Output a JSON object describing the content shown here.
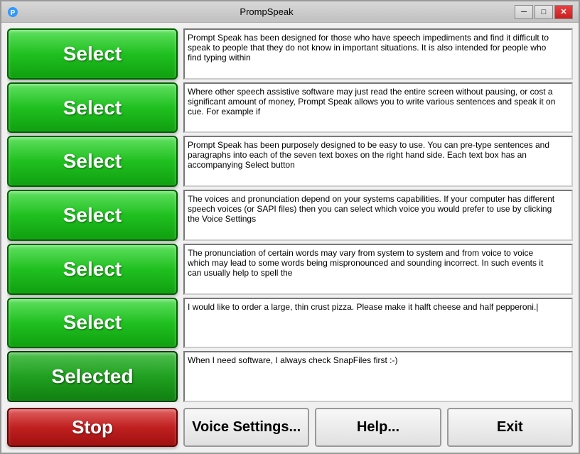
{
  "window": {
    "title": "PrompSpeak"
  },
  "titlebar": {
    "minimize_label": "─",
    "restore_label": "□",
    "close_label": "✕"
  },
  "rows": [
    {
      "id": "row1",
      "button_label": "Select",
      "is_selected": false,
      "text": "Prompt Speak has been designed for those who have speech impediments and find it difficult to speak to people that they do not know in important situations. It is also intended for people who find typing within"
    },
    {
      "id": "row2",
      "button_label": "Select",
      "is_selected": false,
      "text": "Where other speech assistive software may just read the entire screen without pausing, or cost a significant amount of money, Prompt Speak allows you to write various sentences and speak it on cue. For example if"
    },
    {
      "id": "row3",
      "button_label": "Select",
      "is_selected": false,
      "text": "Prompt Speak has been purposely designed to be easy to use. You can pre-type sentences and paragraphs into each of the seven text boxes on the right hand side. Each text box has an accompanying Select button"
    },
    {
      "id": "row4",
      "button_label": "Select",
      "is_selected": false,
      "text": "The voices and pronunciation depend on your systems capabilities. If your computer has different speech voices (or SAPI files) then you can select which voice you would prefer to use by clicking the Voice Settings"
    },
    {
      "id": "row5",
      "button_label": "Select",
      "is_selected": false,
      "text": "The pronunciation of certain words may vary from system to system and from voice to voice which may lead to some words being mispronounced and sounding incorrect. In such events it can usually help to spell the"
    },
    {
      "id": "row6",
      "button_label": "Select",
      "is_selected": false,
      "text": "I would like to order a large, thin crust pizza. Please make it halft cheese and half pepperoni.|"
    },
    {
      "id": "row7",
      "button_label": "Selected",
      "is_selected": true,
      "text": "When I need software, I always check SnapFiles first :-)"
    }
  ],
  "bottom": {
    "stop_label": "Stop",
    "voice_settings_label": "Voice Settings...",
    "help_label": "Help...",
    "exit_label": "Exit"
  }
}
